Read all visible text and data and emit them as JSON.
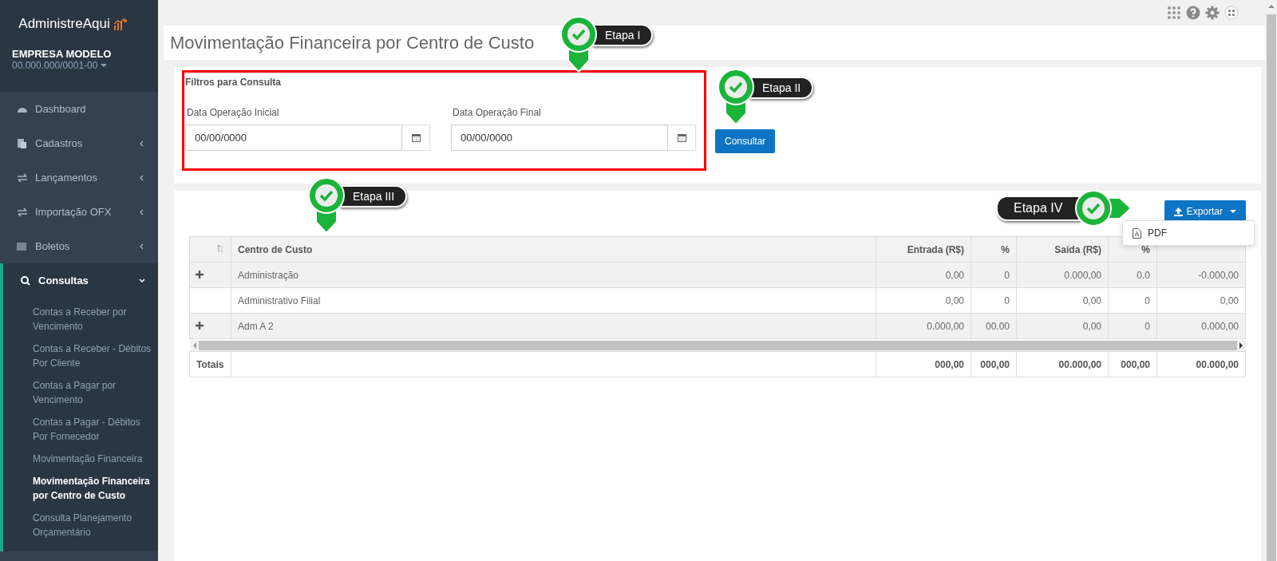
{
  "sidebar": {
    "brand": "AdministreAqui",
    "company": {
      "name": "EMPRESA MODELO",
      "document": "00.000.000/0001-00"
    },
    "items": [
      {
        "label": "Dashboard",
        "kind": "link",
        "expanded": false
      },
      {
        "label": "Cadastros",
        "kind": "group",
        "expanded": false
      },
      {
        "label": "Lançamentos",
        "kind": "group",
        "expanded": false
      },
      {
        "label": "Importação OFX",
        "kind": "group",
        "expanded": false
      },
      {
        "label": "Boletos",
        "kind": "group",
        "expanded": false
      },
      {
        "label": "Consultas",
        "kind": "group",
        "expanded": true,
        "children": [
          {
            "label": "Contas a Receber por Vencimento",
            "selected": false
          },
          {
            "label": "Contas a Receber - Débitos Por Cliente",
            "selected": false
          },
          {
            "label": "Contas a Pagar por Vencimento",
            "selected": false
          },
          {
            "label": "Contas a Pagar - Débitos Por Fornecedor",
            "selected": false
          },
          {
            "label": "Movimentação Financeira",
            "selected": false
          },
          {
            "label": "Movimentação Financeira por Centro de Custo",
            "selected": true
          },
          {
            "label": "Consulta Planejamento Orçamentário",
            "selected": false
          }
        ]
      }
    ]
  },
  "page_title": "Movimentação Financeira por Centro de Custo",
  "filters": {
    "title": "Filtros para Consulta",
    "fields": [
      {
        "label": "Data Operação Inicial",
        "value": "00/00/0000"
      },
      {
        "label": "Data Operação Final",
        "value": "00/00/0000"
      }
    ],
    "submit": "Consultar"
  },
  "export": {
    "label": "Exportar",
    "menu": [
      "PDF"
    ]
  },
  "table": {
    "columns": [
      "Centro de Custo",
      "Entrada (R$)",
      "%",
      "Saída (R$)",
      "%"
    ],
    "rows": [
      {
        "expandable": true,
        "cells": [
          "Administração",
          "0,00",
          "0",
          "0.000,00",
          "0.0",
          "-0.000,00"
        ]
      },
      {
        "expandable": false,
        "cells": [
          "Administrativo Filial",
          "0,00",
          "0",
          "0,00",
          "0",
          "0,00"
        ]
      },
      {
        "expandable": true,
        "cells": [
          "Adm A 2",
          "0.000,00",
          "00.00",
          "0,00",
          "0",
          "0.000,00"
        ]
      }
    ],
    "totals": {
      "label": "Totais",
      "cells": [
        "",
        "000,00",
        "000,00",
        "00.000,00",
        "000,00",
        "00.000,00"
      ]
    }
  },
  "callouts": [
    {
      "label": "Etapa I",
      "kind": "pin-down"
    },
    {
      "label": "Etapa II",
      "kind": "pin-down"
    },
    {
      "label": "Etapa III",
      "kind": "pin-down"
    },
    {
      "label": "Etapa IV",
      "kind": "pin-right"
    }
  ]
}
